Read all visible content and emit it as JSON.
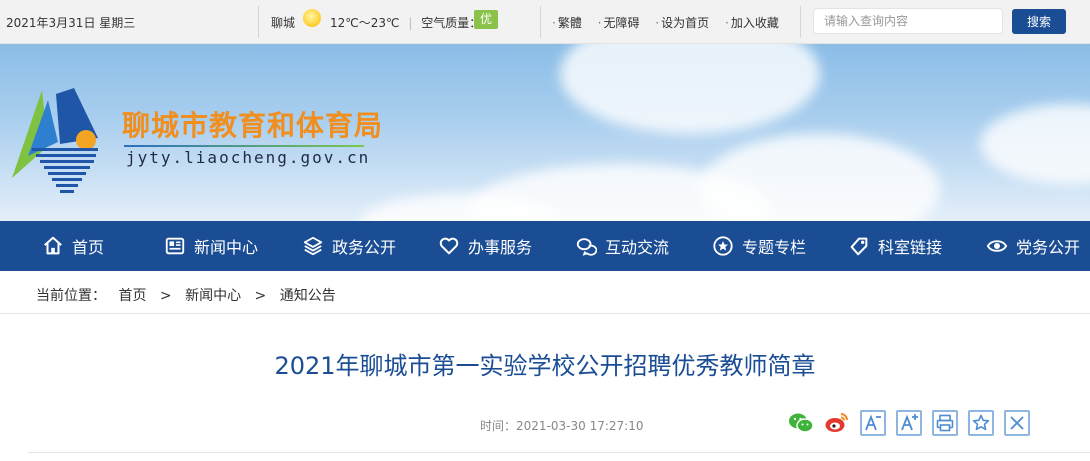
{
  "topbar": {
    "date": "2021年3月31日 星期三",
    "city": "聊城",
    "weather_icon": "sun-icon",
    "temperature": "12℃～23℃",
    "air_quality_label": "空气质量：",
    "air_quality_value": "优",
    "air_quality_color": "#8bc34a",
    "links": [
      "繁體",
      "无障碍",
      "设为首页",
      "加入收藏"
    ],
    "search_placeholder": "请输入查询内容",
    "search_button": "搜索"
  },
  "banner": {
    "site_name": "聊城市教育和体育局",
    "site_url": "jyty.liaocheng.gov.cn",
    "logo": "bureau-logo"
  },
  "nav": {
    "items": [
      {
        "label": "首页",
        "icon": "home-icon"
      },
      {
        "label": "新闻中心",
        "icon": "news-icon"
      },
      {
        "label": "政务公开",
        "icon": "layers-icon"
      },
      {
        "label": "办事服务",
        "icon": "heart-icon"
      },
      {
        "label": "互动交流",
        "icon": "chat-icon"
      },
      {
        "label": "专题专栏",
        "icon": "star-icon"
      },
      {
        "label": "科室链接",
        "icon": "tag-icon"
      },
      {
        "label": "党务公开",
        "icon": "eye-icon"
      }
    ],
    "background": "#1a4d94"
  },
  "breadcrumb": {
    "label": "当前位置：",
    "items": [
      "首页",
      "新闻中心",
      "通知公告"
    ],
    "separator": ">"
  },
  "article": {
    "title": "2021年聊城市第一实验学校公开招聘优秀教师简章",
    "time_label": "时间：",
    "time_value": "2021-03-30 17:27:10",
    "tools": [
      "wechat-share-icon",
      "weibo-share-icon",
      "font-decrease-icon",
      "font-increase-icon",
      "print-icon",
      "favorite-icon",
      "close-icon"
    ]
  }
}
